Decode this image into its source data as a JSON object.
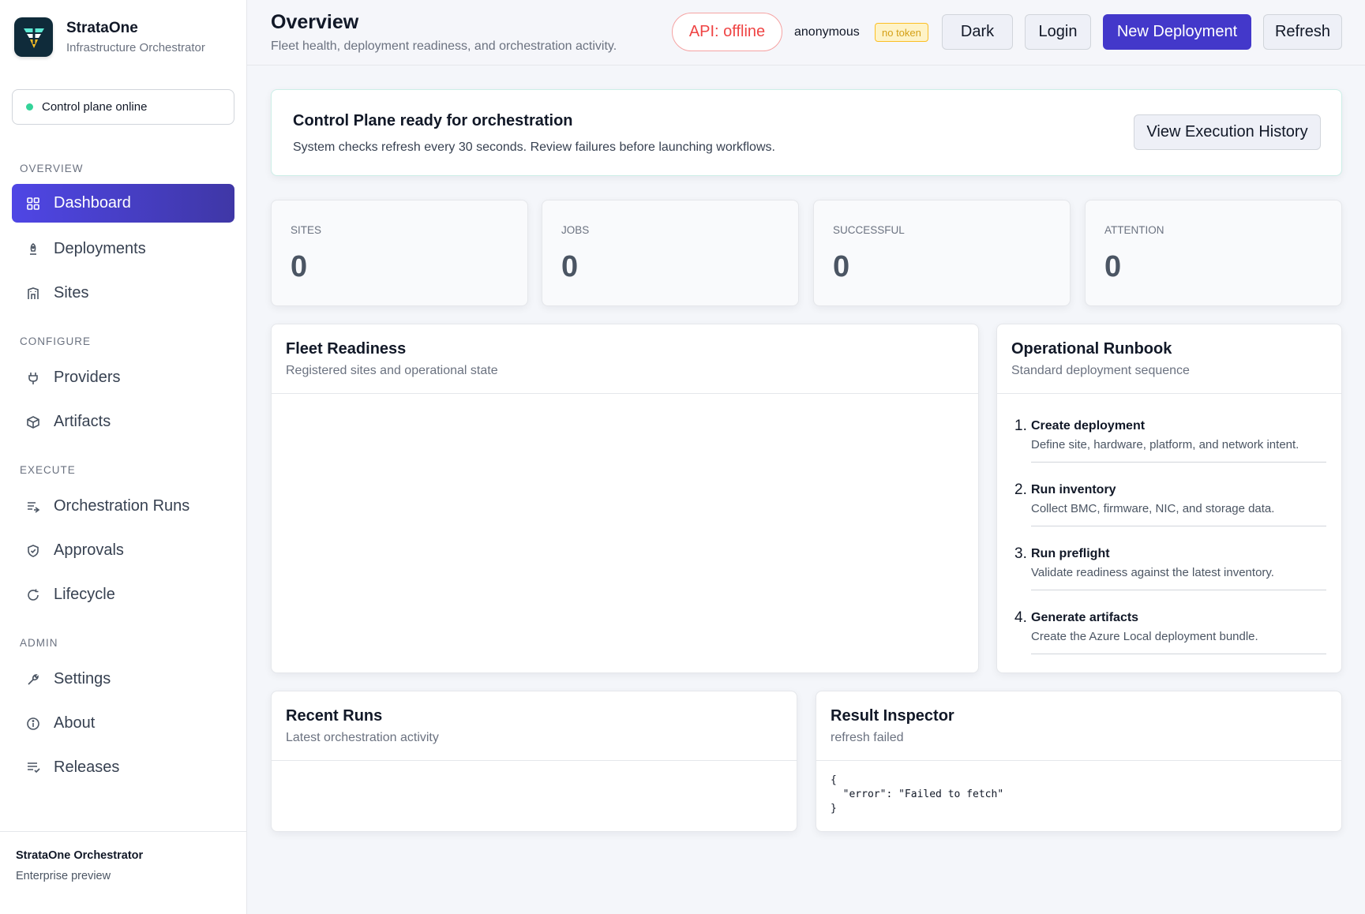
{
  "brand": {
    "name": "StrataOne",
    "subtitle": "Infrastructure Orchestrator"
  },
  "status": {
    "label": "Control plane online",
    "color": "#34d399"
  },
  "nav": {
    "sections": [
      "OVERVIEW",
      "CONFIGURE",
      "EXECUTE",
      "ADMIN"
    ],
    "items": [
      {
        "label": "Dashboard",
        "icon": "grid-icon",
        "active": true
      },
      {
        "label": "Deployments",
        "icon": "rocket-icon"
      },
      {
        "label": "Sites",
        "icon": "building-icon"
      },
      {
        "label": "Providers",
        "icon": "plug-icon"
      },
      {
        "label": "Artifacts",
        "icon": "cube-icon"
      },
      {
        "label": "Orchestration Runs",
        "icon": "list-run-icon"
      },
      {
        "label": "Approvals",
        "icon": "shield-check-icon"
      },
      {
        "label": "Lifecycle",
        "icon": "refresh-icon"
      },
      {
        "label": "Settings",
        "icon": "wrench-icon"
      },
      {
        "label": "About",
        "icon": "info-icon"
      },
      {
        "label": "Releases",
        "icon": "notes-icon"
      }
    ]
  },
  "footer": {
    "title": "StrataOne Orchestrator",
    "subtitle": "Enterprise preview"
  },
  "header": {
    "title": "Overview",
    "subtitle": "Fleet health, deployment readiness, and orchestration activity.",
    "api_status": "API: offline",
    "user": "anonymous",
    "token": "no token",
    "buttons": {
      "dark": "Dark",
      "login": "Login",
      "new_deployment": "New Deployment",
      "refresh": "Refresh"
    }
  },
  "banner": {
    "title": "Control Plane ready for orchestration",
    "subtitle": "System checks refresh every 30 seconds. Review failures before launching workflows.",
    "button": "View Execution History"
  },
  "stats": [
    {
      "label": "SITES",
      "value": "0"
    },
    {
      "label": "JOBS",
      "value": "0"
    },
    {
      "label": "SUCCESSFUL",
      "value": "0"
    },
    {
      "label": "ATTENTION",
      "value": "0"
    }
  ],
  "fleet": {
    "title": "Fleet Readiness",
    "subtitle": "Registered sites and operational state"
  },
  "runbook": {
    "title": "Operational Runbook",
    "subtitle": "Standard deployment sequence",
    "steps": [
      {
        "num": "1.",
        "title": "Create deployment",
        "desc": "Define site, hardware, platform, and network intent."
      },
      {
        "num": "2.",
        "title": "Run inventory",
        "desc": "Collect BMC, firmware, NIC, and storage data."
      },
      {
        "num": "3.",
        "title": "Run preflight",
        "desc": "Validate readiness against the latest inventory."
      },
      {
        "num": "4.",
        "title": "Generate artifacts",
        "desc": "Create the Azure Local deployment bundle."
      }
    ]
  },
  "recent": {
    "title": "Recent Runs",
    "subtitle": "Latest orchestration activity"
  },
  "inspector": {
    "title": "Result Inspector",
    "subtitle": "refresh failed",
    "output": "{\n  \"error\": \"Failed to fetch\"\n}"
  }
}
